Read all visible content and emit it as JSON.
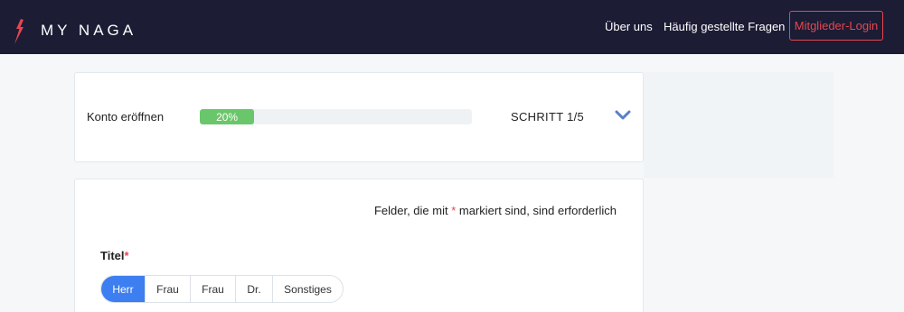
{
  "header": {
    "logo_text": "MY NAGA",
    "nav": {
      "about": "Über uns",
      "faq": "Häufig gestellte Fragen"
    },
    "login_label": "Mitglieder-Login"
  },
  "progress": {
    "title": "Konto eröffnen",
    "percent_label": "20%",
    "percent_value": 0.2,
    "step_label": "SCHRITT 1/5"
  },
  "form": {
    "required_note_prefix": "Felder, die mit ",
    "required_star": "*",
    "required_note_suffix": " markiert sind, sind erforderlich",
    "title_field": {
      "label": "Titel",
      "required_star": "*",
      "options": [
        "Herr",
        "Frau",
        "Frau",
        "Dr.",
        "Sonstiges"
      ],
      "selected": "Herr"
    }
  },
  "colors": {
    "topbar": "#1c1c35",
    "accent_red": "#e5474f",
    "progress_green": "#6ac66b",
    "selected_blue": "#3d7ef0",
    "chevron_blue": "#5a7fc8"
  },
  "icons": {
    "logo": "flame-logo-icon",
    "expand": "chevron-down-icon"
  }
}
